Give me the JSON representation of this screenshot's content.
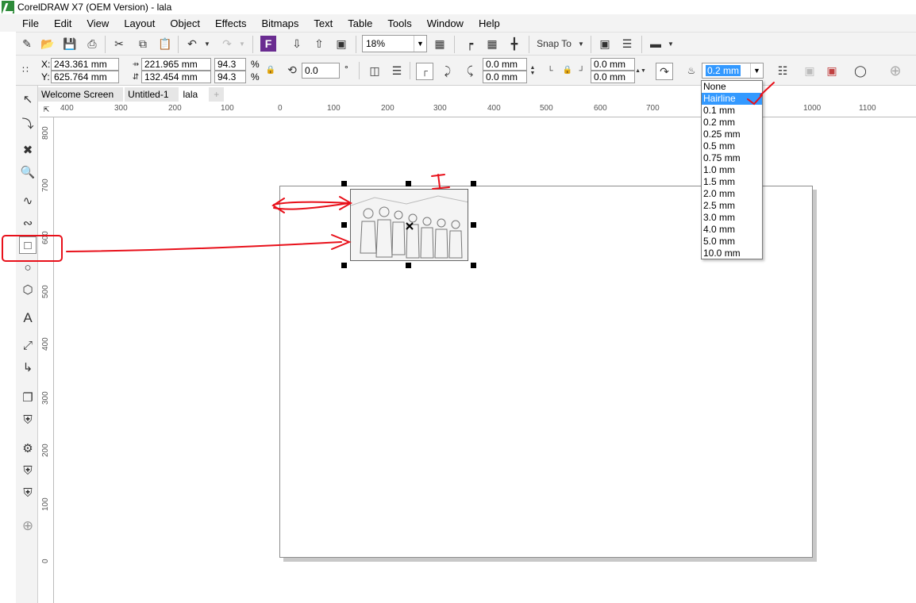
{
  "window": {
    "title": "CorelDRAW X7 (OEM Version) - lala"
  },
  "menu": [
    "File",
    "Edit",
    "View",
    "Layout",
    "Object",
    "Effects",
    "Bitmaps",
    "Text",
    "Table",
    "Tools",
    "Window",
    "Help"
  ],
  "standard_toolbar": {
    "zoom": "18%",
    "snap_to": "Snap To"
  },
  "property_bar": {
    "x_label": "X:",
    "x_value": "243.361 mm",
    "y_label": "Y:",
    "y_value": "625.764 mm",
    "width_value": "221.965 mm",
    "height_value": "132.454 mm",
    "scale_x": "94.3",
    "scale_y": "94.3",
    "percent": "%",
    "rotation": "0.0",
    "degree": "°",
    "corner_tl": "0.0 mm",
    "corner_bl": "0.0 mm",
    "corner_tr": "0.0 mm",
    "corner_br": "0.0 mm",
    "outline_width": "0.2 mm"
  },
  "outline_dropdown": {
    "options": [
      "None",
      "Hairline",
      "0.1 mm",
      "0.2 mm",
      "0.25 mm",
      "0.5 mm",
      "0.75 mm",
      "1.0 mm",
      "1.5 mm",
      "2.0 mm",
      "2.5 mm",
      "3.0 mm",
      "4.0 mm",
      "5.0 mm",
      "10.0 mm"
    ],
    "highlighted": "Hairline"
  },
  "tabs": [
    "Welcome Screen",
    "Untitled-1",
    "lala"
  ],
  "active_tab": "lala",
  "h_ruler": [
    "400",
    "300",
    "200",
    "100",
    "0",
    "100",
    "200",
    "300",
    "400",
    "500",
    "600",
    "700",
    "1000",
    "1100"
  ],
  "v_ruler": [
    "800",
    "700",
    "600",
    "500",
    "400",
    "300",
    "200",
    "100",
    "0"
  ],
  "annotation_text": "I",
  "annotation_color": "#e8101a"
}
